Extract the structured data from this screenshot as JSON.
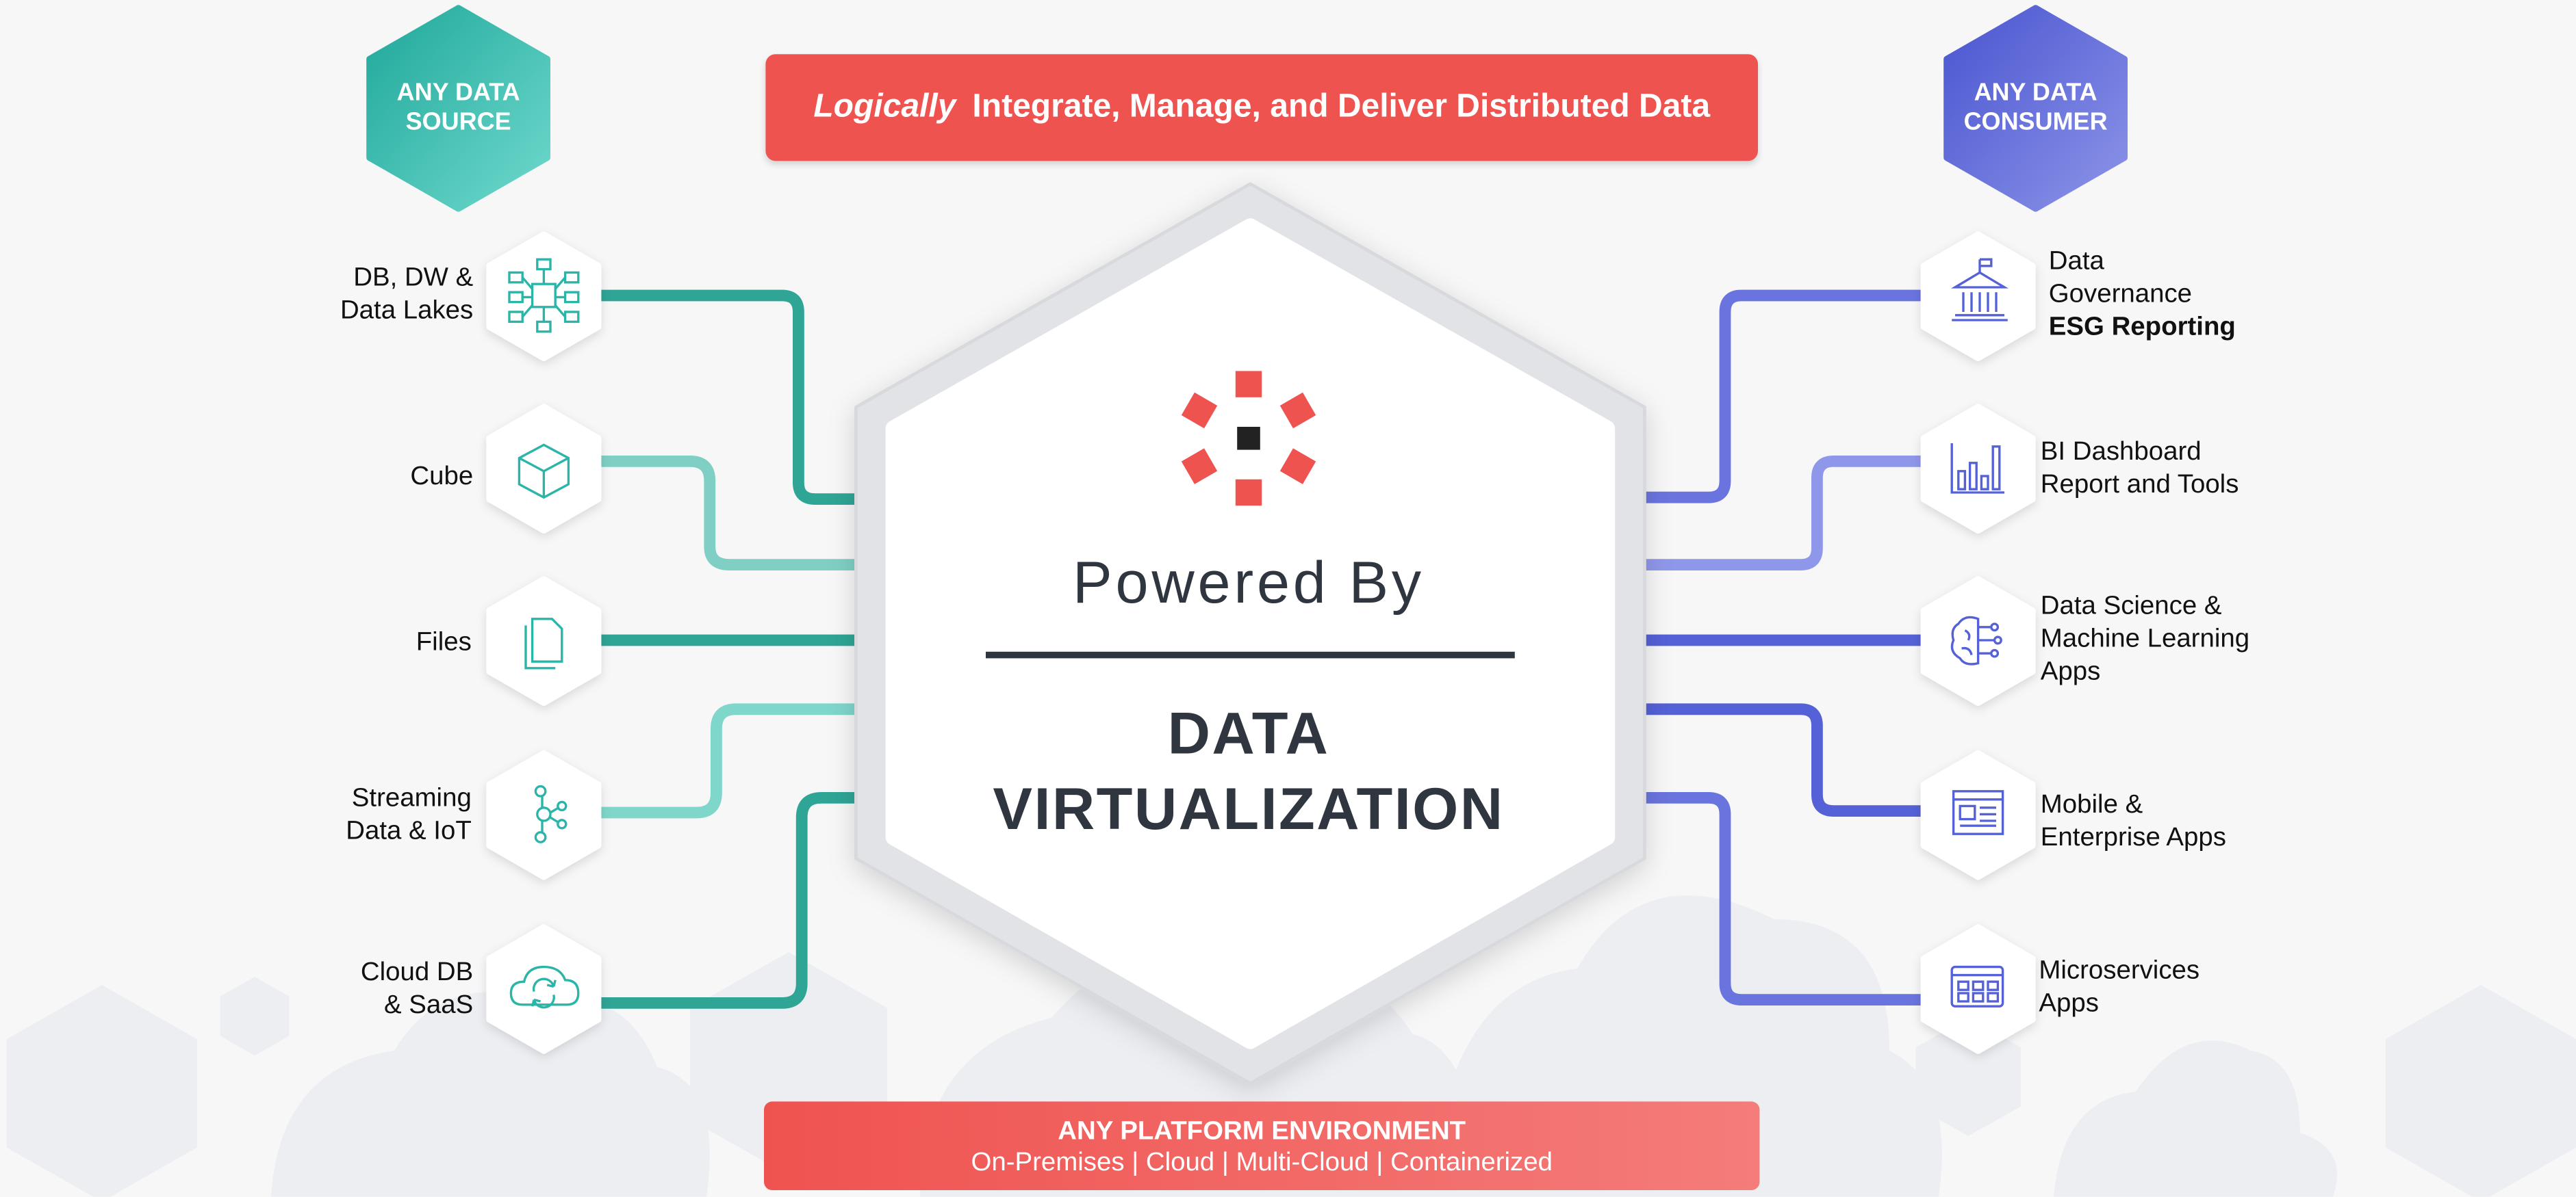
{
  "header": {
    "emphasis": "Logically",
    "title": "Integrate, Manage, and Deliver Distributed Data"
  },
  "source_badge": {
    "line1": "ANY DATA",
    "line2": "SOURCE"
  },
  "consumer_badge": {
    "line1": "ANY DATA",
    "line2": "CONSUMER"
  },
  "center": {
    "powered_by": "Powered By",
    "line1": "DATA",
    "line2": "VIRTUALIZATION"
  },
  "sources": [
    {
      "line1": "DB, DW &",
      "line2": "Data Lakes",
      "icon": "database-network-icon"
    },
    {
      "line1": "Cube",
      "line2": "",
      "icon": "cube-icon"
    },
    {
      "line1": "Files",
      "line2": "",
      "icon": "files-icon"
    },
    {
      "line1": "Streaming",
      "line2": "Data & IoT",
      "icon": "streaming-icon"
    },
    {
      "line1": "Cloud DB",
      "line2": "& SaaS",
      "icon": "cloud-sync-icon"
    }
  ],
  "consumers": [
    {
      "line1": "Data",
      "line2": "Governance",
      "line3": "ESG Reporting",
      "icon": "governance-building-icon"
    },
    {
      "line1": "BI Dashboard",
      "line2": "Report and Tools",
      "icon": "bar-chart-icon"
    },
    {
      "line1": "Data Science &",
      "line2": "Machine Learning",
      "line3": "Apps",
      "icon": "brain-network-icon"
    },
    {
      "line1": "Mobile &",
      "line2": "Enterprise Apps",
      "icon": "app-window-icon"
    },
    {
      "line1": "Microservices",
      "line2": "Apps",
      "icon": "microservices-grid-icon"
    }
  ],
  "footer": {
    "title": "ANY PLATFORM ENVIRONMENT",
    "subtitle": "On-Premises | Cloud | Multi-Cloud | Containerized"
  },
  "colors": {
    "accent_red": "#ef5350",
    "teal": "#2bb5a8",
    "indigo": "#5561d6",
    "dark_text": "#2f3640"
  }
}
